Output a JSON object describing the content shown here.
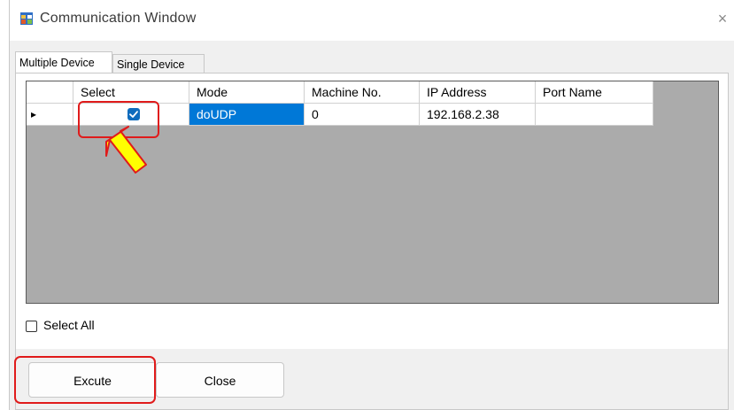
{
  "window": {
    "title": "Communication  Window",
    "close_glyph": "×"
  },
  "tabs": [
    {
      "label": "Multiple Device",
      "active": true
    },
    {
      "label": "Single Device",
      "active": false
    }
  ],
  "grid": {
    "columns": [
      "Select",
      "Mode",
      "Machine No.",
      "IP Address",
      "Port Name"
    ],
    "rows": [
      {
        "row_indicator": "▸",
        "select_checked": true,
        "mode": "doUDP",
        "machine_no": "0",
        "ip_address": "192.168.2.38",
        "port_name": ""
      }
    ]
  },
  "select_all": {
    "label": "Select All",
    "checked": false
  },
  "buttons": {
    "execute_label": "Excute",
    "close_label": "Close"
  },
  "annotations": {
    "highlight_color": "#e01b1b",
    "arrow_fill": "#ffff00",
    "arrow_stroke": "#e01b1b"
  },
  "icons": {
    "app": "app-window-icon",
    "close": "close-icon",
    "checkbox": "checkmark-icon",
    "row_indicator": "row-pointer-icon"
  }
}
